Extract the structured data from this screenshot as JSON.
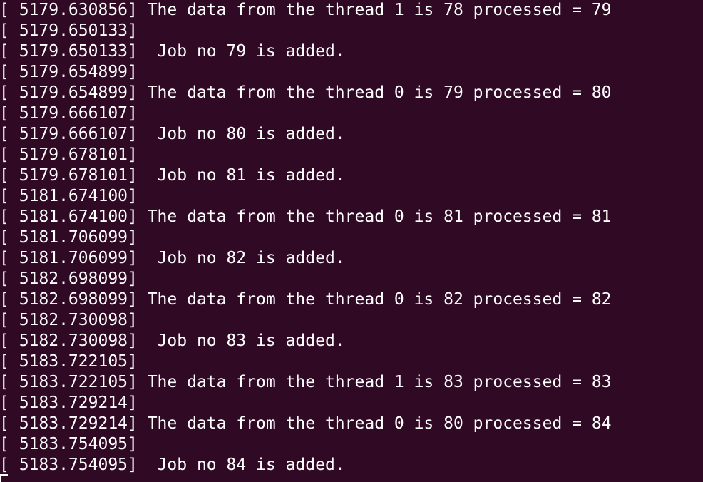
{
  "terminal": {
    "lines": [
      "[ 5179.630856] The data from the thread 1 is 78 processed = 79",
      "[ 5179.650133]",
      "[ 5179.650133]  Job no 79 is added.",
      "[ 5179.654899]",
      "[ 5179.654899] The data from the thread 0 is 79 processed = 80",
      "[ 5179.666107]",
      "[ 5179.666107]  Job no 80 is added.",
      "[ 5179.678101]",
      "[ 5179.678101]  Job no 81 is added.",
      "[ 5181.674100]",
      "[ 5181.674100] The data from the thread 0 is 81 processed = 81",
      "[ 5181.706099]",
      "[ 5181.706099]  Job no 82 is added.",
      "[ 5182.698099]",
      "[ 5182.698099] The data from the thread 0 is 82 processed = 82",
      "[ 5182.730098]",
      "[ 5182.730098]  Job no 83 is added.",
      "[ 5183.722105]",
      "[ 5183.722105] The data from the thread 1 is 83 processed = 83",
      "[ 5183.729214]",
      "[ 5183.729214] The data from the thread 0 is 80 processed = 84",
      "[ 5183.754095]",
      "[ 5183.754095]  Job no 84 is added."
    ]
  },
  "colors": {
    "background": "#300a24",
    "text": "#ffffff"
  }
}
